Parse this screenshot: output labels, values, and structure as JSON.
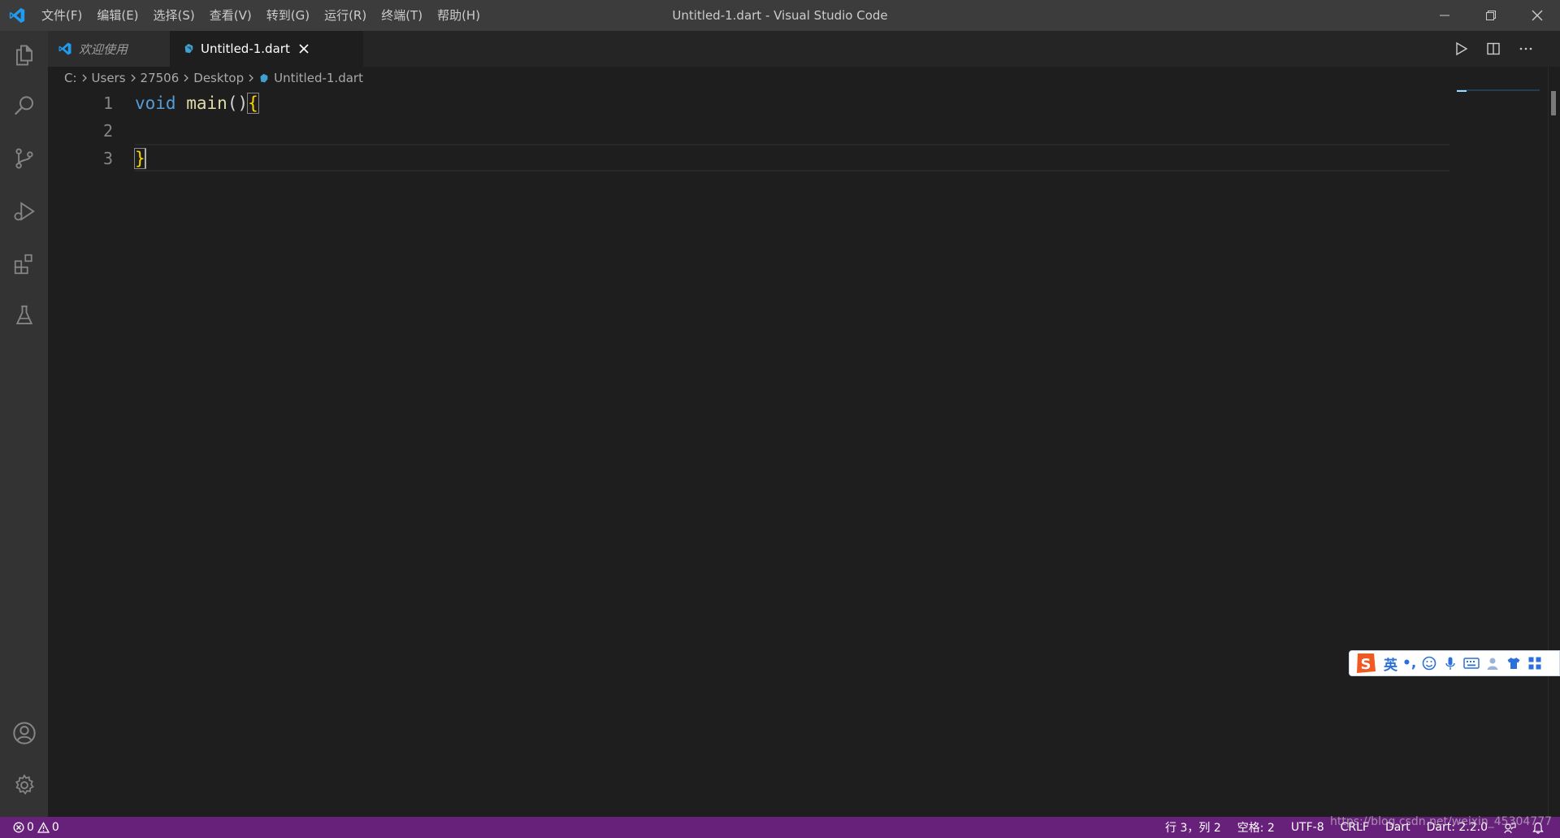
{
  "titlebar": {
    "menus": [
      "文件(F)",
      "编辑(E)",
      "选择(S)",
      "查看(V)",
      "转到(G)",
      "运行(R)",
      "终端(T)",
      "帮助(H)"
    ],
    "window_title": "Untitled-1.dart - Visual Studio Code"
  },
  "activitybar": {
    "items": [
      "explorer-icon",
      "search-icon",
      "source-control-icon",
      "run-debug-icon",
      "extensions-icon",
      "testing-icon"
    ],
    "bottom": [
      "account-icon",
      "settings-gear-icon"
    ]
  },
  "tabs": [
    {
      "label": "欢迎使用",
      "active": false
    },
    {
      "label": "Untitled-1.dart",
      "active": true
    }
  ],
  "breadcrumbs": [
    "C:",
    "Users",
    "27506",
    "Desktop",
    "Untitled-1.dart"
  ],
  "editor": {
    "line_numbers": [
      "1",
      "2",
      "3"
    ],
    "code": {
      "keyword": "void",
      "function": "main",
      "parens": "()",
      "open_brace": "{",
      "close_brace": "}"
    }
  },
  "ime": {
    "mode": "英",
    "punct": "•,"
  },
  "statusbar": {
    "errors": "0",
    "warnings": "0",
    "position": "行 3，列 2",
    "spaces": "空格: 2",
    "encoding": "UTF-8",
    "eol": "CRLF",
    "language": "Dart",
    "sdk": "Dart: 2.2.0"
  },
  "watermark": "https://blog.csdn.net/weixin_45304777",
  "colors": {
    "statusbar": "#68217a",
    "titlebar": "#3c3c3c",
    "editor_bg": "#1e1e1e",
    "keyword": "#569cd6",
    "function": "#dcdcaa"
  }
}
